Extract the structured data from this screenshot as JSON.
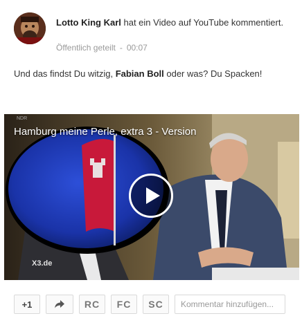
{
  "post": {
    "author_name": "Lotto King Karl",
    "action_text": " hat ein Video auf YouTube kommentiert.",
    "visibility": "Öffentlich geteilt",
    "separator": "-",
    "time": "00:07",
    "text_before": "Und das findst Du witzig, ",
    "mention": "Fabian Boll",
    "text_after": " oder was? Du Spacken!"
  },
  "video": {
    "title": "Hamburg meine Perle, extra 3 - Version",
    "watermark": "X3.de",
    "play_icon": "play-icon"
  },
  "actions": {
    "plus_one_label": "+1",
    "share_icon": "share-arrow-icon",
    "rc_label": "RC",
    "fc_label": "FC",
    "sc_label": "SC",
    "comment_placeholder": "Kommentar hinzufügen..."
  }
}
